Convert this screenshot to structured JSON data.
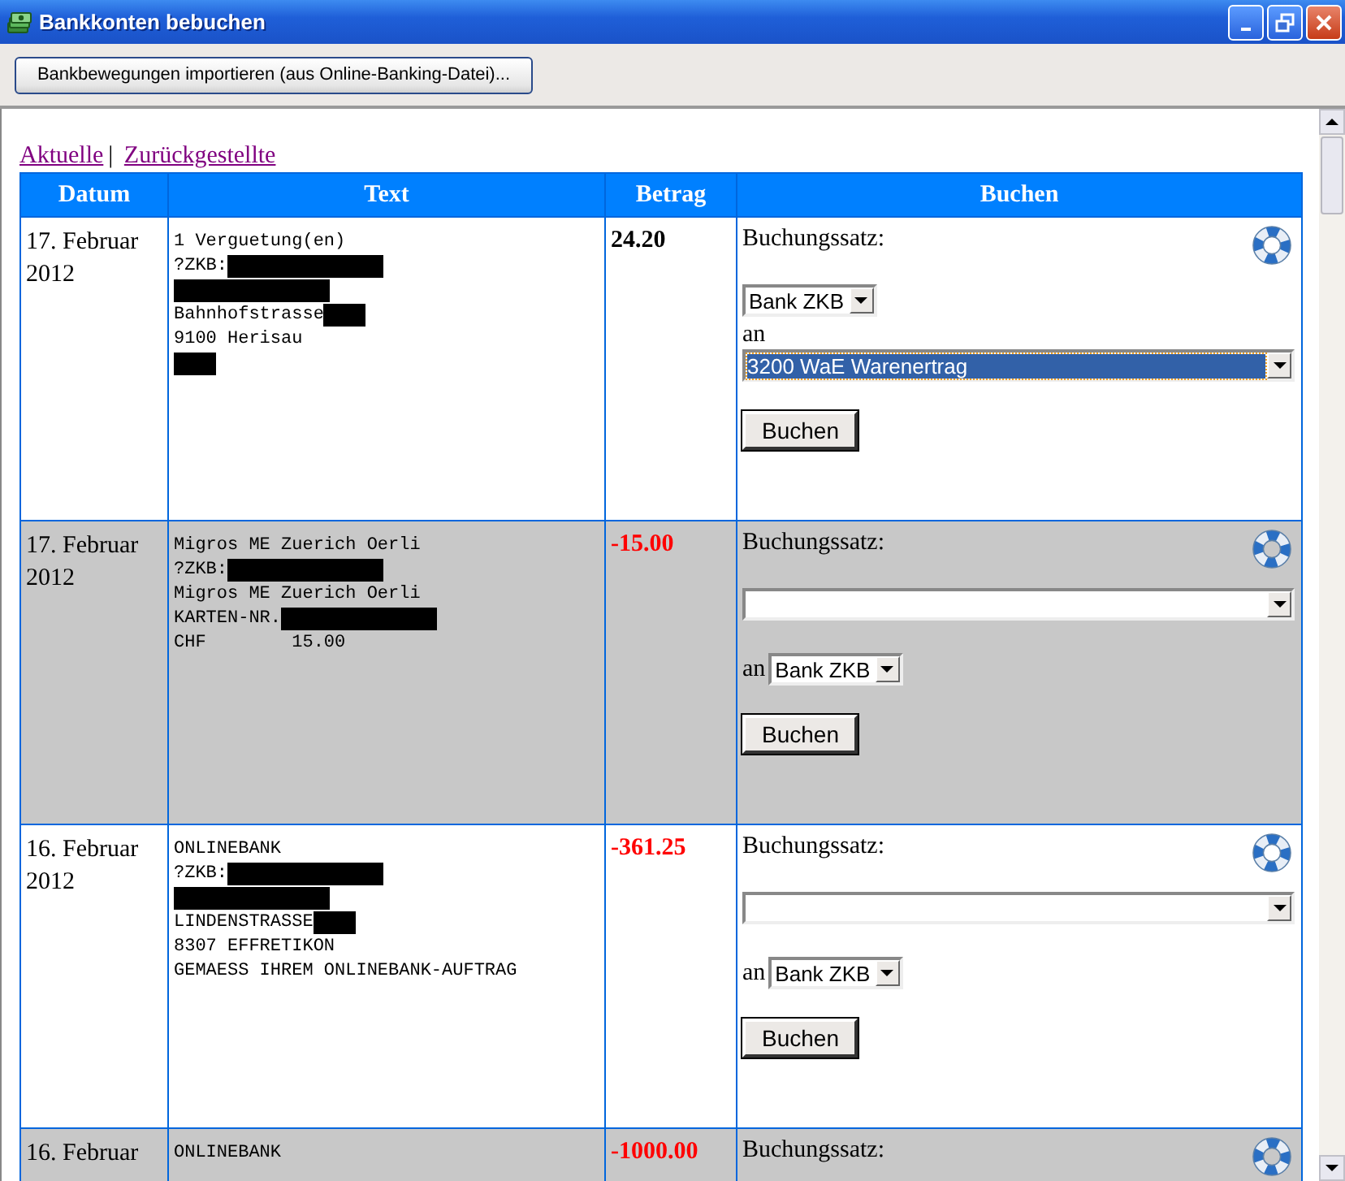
{
  "window": {
    "title": "Bankkonten bebuchen"
  },
  "toolbar": {
    "import_button": "Bankbewegungen importieren (aus Online-Banking-Datei)..."
  },
  "view_links": {
    "items": [
      {
        "label": "Aktuelle"
      },
      {
        "label": "Zurückgestellte"
      }
    ],
    "separator": "|"
  },
  "table": {
    "columns": [
      "Datum",
      "Text",
      "Betrag",
      "Buchen"
    ],
    "rows": [
      {
        "date": [
          "17. Februar",
          "2012"
        ],
        "text_lines": [
          [
            {
              "kind": "text",
              "text": "1 Verguetung(en)"
            }
          ],
          [
            {
              "kind": "text",
              "text": "?ZKB:"
            },
            {
              "kind": "redacted"
            }
          ],
          [
            {
              "kind": "redacted"
            }
          ],
          [
            {
              "kind": "text",
              "text": "Bahnhofstrasse"
            },
            {
              "kind": "redacted-small"
            }
          ],
          [
            {
              "kind": "text",
              "text": "9100 Herisau"
            }
          ],
          [
            {
              "kind": "redacted-small"
            }
          ]
        ],
        "amount": "24.20",
        "negative": false,
        "booking": {
          "label": "Buchungssatz:",
          "connector": "an",
          "selects": [
            {
              "kind": "compact",
              "value": "Bank ZKB",
              "focused": false
            },
            {
              "kind": "wide",
              "value": "3200 WaE Warenertrag",
              "focused": true
            }
          ],
          "button": "Buchen"
        }
      },
      {
        "date": [
          "17. Februar",
          "2012"
        ],
        "text_lines": [
          [
            {
              "kind": "text",
              "text": "Migros ME Zuerich Oerli"
            }
          ],
          [
            {
              "kind": "text",
              "text": "?ZKB:"
            },
            {
              "kind": "redacted"
            }
          ],
          [
            {
              "kind": "text",
              "text": "Migros ME Zuerich Oerli"
            }
          ],
          [
            {
              "kind": "text",
              "text": "KARTEN-NR."
            },
            {
              "kind": "redacted"
            }
          ],
          [
            {
              "kind": "text",
              "text": "CHF        15.00"
            }
          ]
        ],
        "amount": "-15.00",
        "negative": true,
        "booking": {
          "label": "Buchungssatz:",
          "connector": "an",
          "selects": [
            {
              "kind": "wide",
              "focused": false
            },
            {
              "kind": "compact",
              "value": "Bank ZKB",
              "focused": false
            }
          ],
          "button": "Buchen"
        }
      },
      {
        "date": [
          "16. Februar",
          "2012"
        ],
        "text_lines": [
          [
            {
              "kind": "text",
              "text": "ONLINEBANK"
            }
          ],
          [
            {
              "kind": "text",
              "text": "?ZKB:"
            },
            {
              "kind": "redacted"
            }
          ],
          [
            {
              "kind": "redacted"
            }
          ],
          [
            {
              "kind": "text",
              "text": "LINDENSTRASSE"
            },
            {
              "kind": "redacted-small"
            }
          ],
          [
            {
              "kind": "text",
              "text": "8307 EFFRETIKON"
            }
          ],
          [
            {
              "kind": "text",
              "text": "GEMAESS IHREM ONLINEBANK-AUFTRAG"
            }
          ]
        ],
        "amount": "-361.25",
        "negative": true,
        "booking": {
          "label": "Buchungssatz:",
          "connector": "an",
          "selects": [
            {
              "kind": "wide",
              "focused": false
            },
            {
              "kind": "compact",
              "value": "Bank ZKB",
              "focused": false
            }
          ],
          "button": "Buchen"
        }
      },
      {
        "date": [
          "16. Februar"
        ],
        "text_lines": [
          [
            {
              "kind": "text",
              "text": "ONLINEBANK"
            }
          ]
        ],
        "amount": "-1000.00",
        "negative": true,
        "booking": {
          "label": "Buchungssatz:"
        }
      }
    ]
  }
}
